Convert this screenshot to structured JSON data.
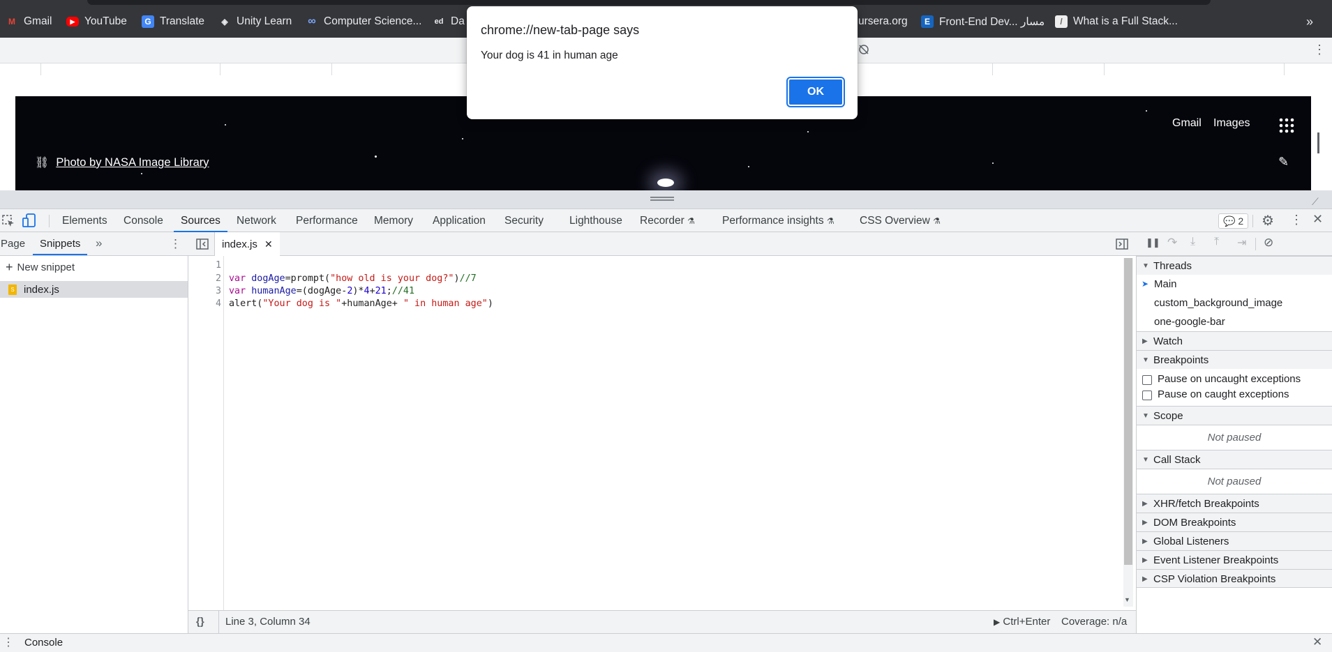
{
  "bookmarks": [
    {
      "label": "Gmail",
      "icon": "gmail-icon",
      "color": "#ea4335",
      "glyph": "M"
    },
    {
      "label": "YouTube",
      "icon": "youtube-icon",
      "color": "#ff0000",
      "glyph": "▶"
    },
    {
      "label": "Translate",
      "icon": "translate-icon",
      "color": "#4285f4",
      "glyph": "G"
    },
    {
      "label": "Unity Learn",
      "icon": "unity-icon",
      "color": "#35363a",
      "glyph": "◈"
    },
    {
      "label": "Computer Science...",
      "icon": "infinity-icon",
      "color": "#35363a",
      "glyph": "∞"
    },
    {
      "label": "Da",
      "icon": "edx-icon",
      "color": "#35363a",
      "glyph": "ed"
    },
    {
      "label": "ursera.org",
      "icon": "coursera-icon",
      "color": "#35363a",
      "glyph": ""
    },
    {
      "label": "Front-End Dev... مسار",
      "icon": "e-icon",
      "color": "#1565c0",
      "glyph": "E"
    },
    {
      "label": "What is a Full Stack...",
      "icon": "page-icon",
      "color": "#eeeeee",
      "glyph": "/"
    }
  ],
  "bookmarks_overflow": "»",
  "newtab": {
    "photo_credit": "Photo by NASA Image Library",
    "gmail": "Gmail",
    "images": "Images"
  },
  "devtools": {
    "tabs": [
      "Elements",
      "Console",
      "Sources",
      "Network",
      "Performance",
      "Memory",
      "Application",
      "Security",
      "Lighthouse",
      "Recorder",
      "Performance insights",
      "CSS Overview"
    ],
    "active_tab": "Sources",
    "issues_count": "2",
    "navigator_tabs": [
      "Page",
      "Snippets"
    ],
    "new_snippet": "New snippet",
    "file": "index.js",
    "editor_tab": "index.js",
    "code_lines": [
      "1",
      "2",
      "3",
      "4"
    ],
    "status_position": "Line 3, Column 34",
    "run_hint": "Ctrl+Enter",
    "coverage": "Coverage: n/a",
    "console_drawer": "Console"
  },
  "debugger": {
    "threads_label": "Threads",
    "threads": [
      "Main",
      "custom_background_image",
      "one-google-bar"
    ],
    "watch": "Watch",
    "breakpoints": "Breakpoints",
    "pause_uncaught": "Pause on uncaught exceptions",
    "pause_caught": "Pause on caught exceptions",
    "scope": "Scope",
    "not_paused": "Not paused",
    "call_stack": "Call Stack",
    "xhr": "XHR/fetch Breakpoints",
    "dom": "DOM Breakpoints",
    "global": "Global Listeners",
    "event": "Event Listener Breakpoints",
    "csp": "CSP Violation Breakpoints"
  },
  "dialog": {
    "title": "chrome://new-tab-page says",
    "message": "Your dog is 41 in human age",
    "ok": "OK"
  }
}
